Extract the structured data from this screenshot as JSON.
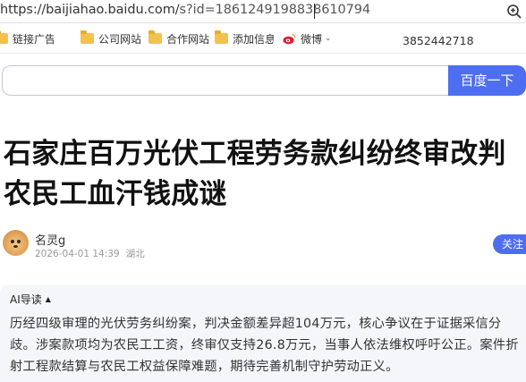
{
  "browser": {
    "url": "https://baijiahao.baidu.com/s?id=1861249198838610794",
    "url_host": "https://baijiahao.baidu.com/",
    "url_query": "s?id=1861249198838610794",
    "zoom_icon": "zoom-icon"
  },
  "bookmarks": {
    "items": [
      {
        "label": "链接广告",
        "icon": "folder-icon"
      },
      {
        "label": "公司网站",
        "icon": "folder-icon"
      },
      {
        "label": "合作网站",
        "icon": "folder-icon"
      },
      {
        "label": "添加信息",
        "icon": "folder-icon"
      },
      {
        "label": "微博",
        "icon": "weibo-icon"
      }
    ],
    "phone": "3852442718"
  },
  "search": {
    "placeholder": "",
    "button_label": "百度一下"
  },
  "article": {
    "title": "石家庄百万光伏工程劳务款纠纷终审改判农民工血汗钱成谜",
    "author": "名灵g",
    "date": "2026-04-01 14:39",
    "location": "湖北",
    "follow_label": "关注"
  },
  "ai_summary": {
    "heading": "AI导读",
    "toggle": "▲",
    "body": "历经四级审理的光伏劳务纠纷案，判决金额差异超104万元，核心争议在于证据采信分歧。涉案款项均为农民工工资，终审仅支持26.8万元，当事人依法维权呼吁公正。案件折射工程款结算与农民工权益保障难题，期待完善机制守护劳动正义。"
  },
  "colors": {
    "accent": "#4e6ef2",
    "folder": "#f3c14d",
    "panel_bg": "#f5f6f9"
  }
}
